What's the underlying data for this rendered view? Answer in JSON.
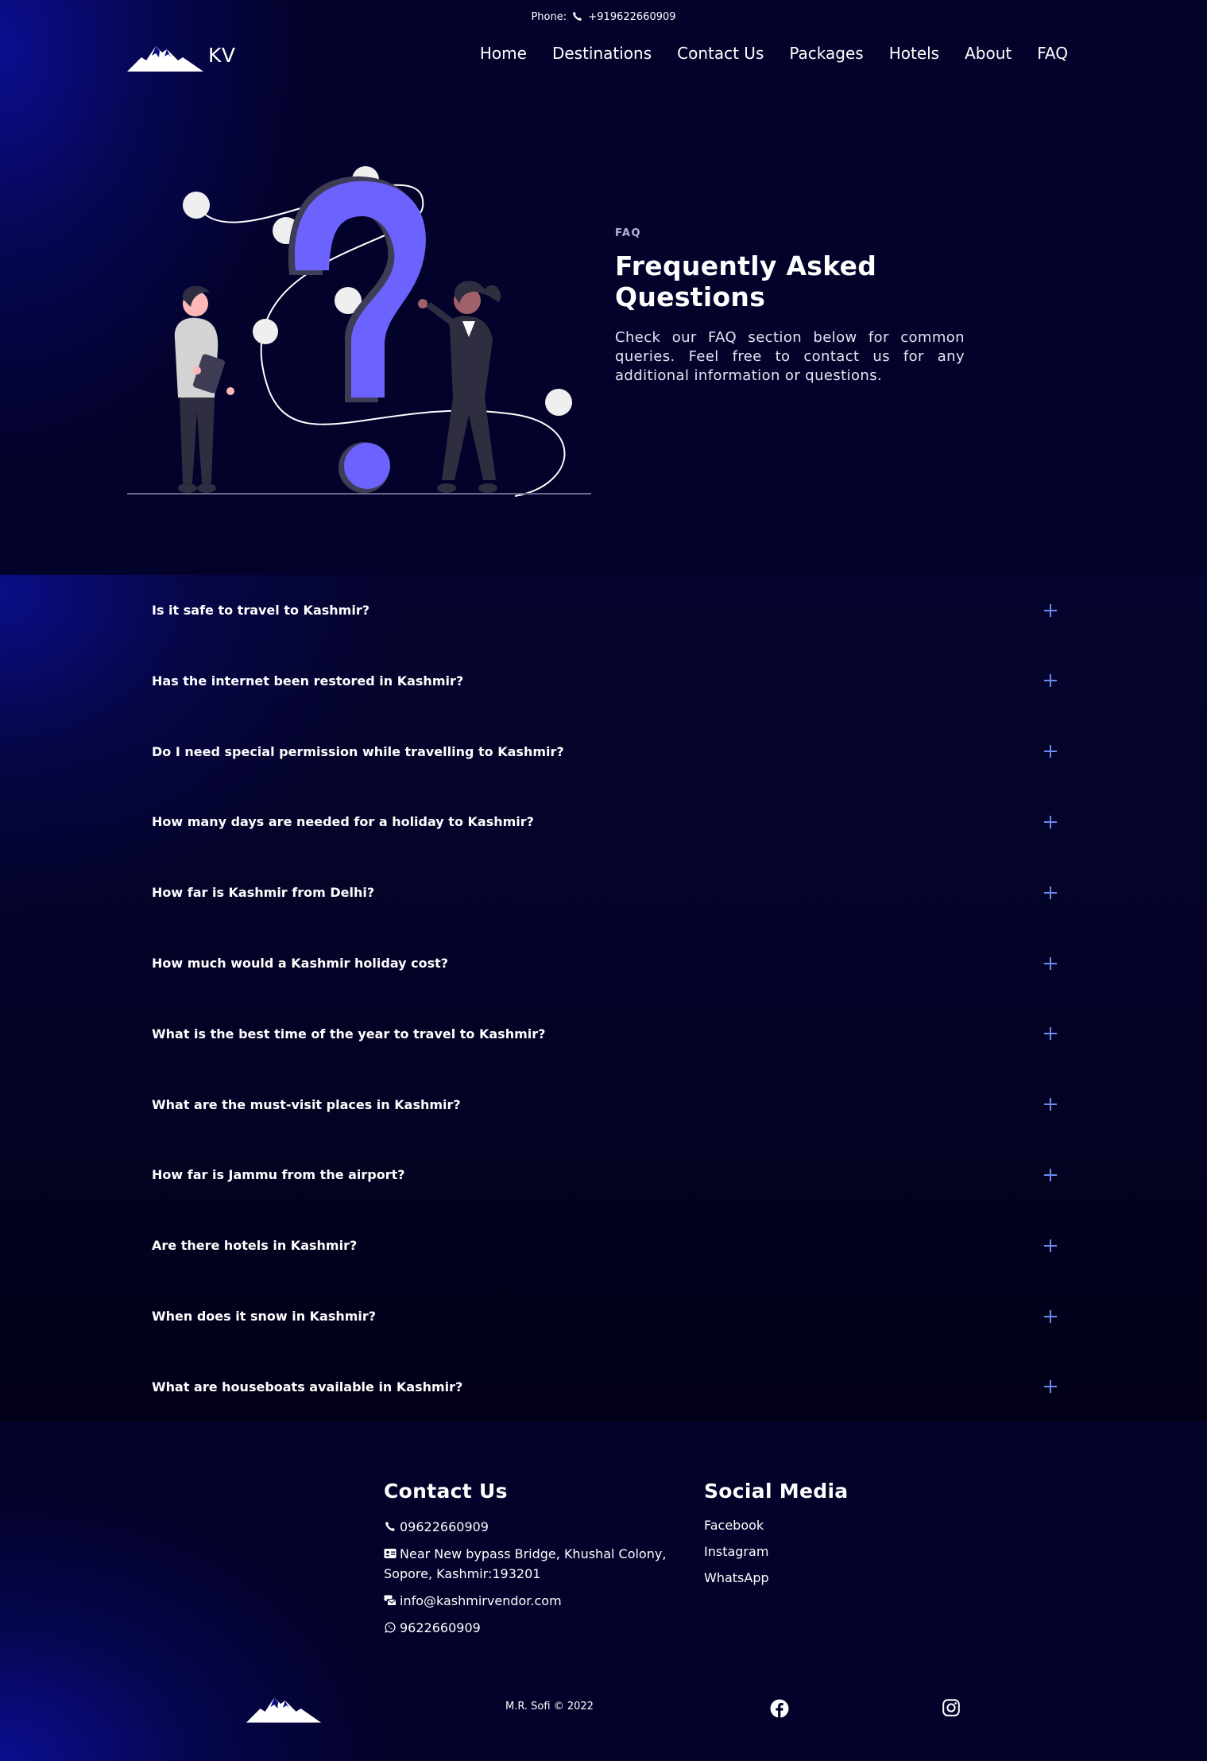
{
  "header": {
    "phone_label": "Phone:",
    "phone_number": "+919622660909",
    "brand": "KV",
    "nav": [
      "Home",
      "Destinations",
      "Contact Us",
      "Packages",
      "Hotels",
      "About",
      "FAQ"
    ]
  },
  "hero": {
    "label": "FAQ",
    "title": "Frequently Asked Questions",
    "description": "Check our FAQ section below for common queries. Feel free to contact us for any additional information or questions."
  },
  "faq": {
    "questions": [
      "Is it safe to travel to Kashmir?",
      "Has the internet been restored in Kashmir?",
      "Do I need special permission while travelling to Kashmir?",
      "How many days are needed for a holiday to Kashmir?",
      "How far is Kashmir from Delhi?",
      "How much would a Kashmir holiday cost?",
      "What is the best time of the year to travel to Kashmir?",
      "What are the must-visit places in Kashmir?",
      "How far is Jammu from the airport?",
      "Are there hotels in Kashmir?",
      "When does it snow in Kashmir?",
      "What are houseboats available in Kashmir?"
    ],
    "expand_icon": "plus-icon",
    "accent_color": "#6b8af0"
  },
  "footer": {
    "contact_heading": "Contact Us",
    "phone": "09622660909",
    "address": "Near New bypass Bridge, Khushal Colony, Sopore, Kashmir:193201",
    "email": "info@kashmirvendor.com",
    "whatsapp": "9622660909",
    "social_heading": "Social Media",
    "social_links": [
      "Facebook",
      "Instagram",
      "WhatsApp"
    ],
    "copyright": "M.R. Sofi © 2022"
  },
  "colors": {
    "background": "#03022a",
    "accent_blue": "#0c0e96",
    "question_mark": "#6c63ff"
  }
}
